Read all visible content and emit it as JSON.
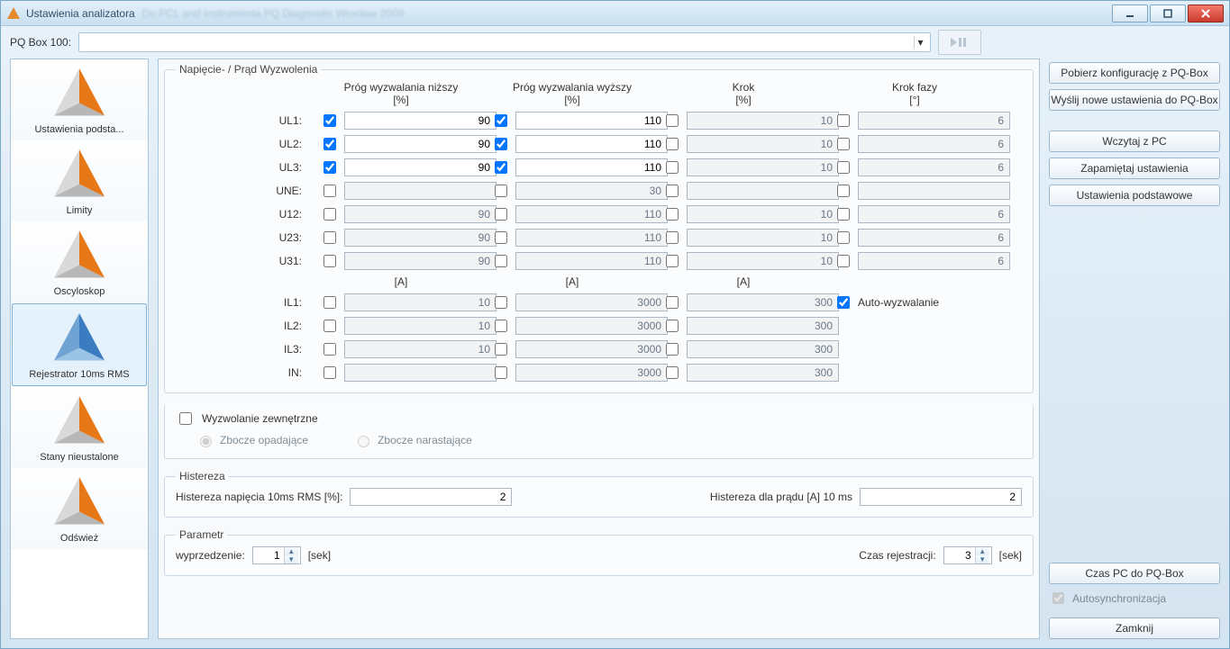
{
  "window": {
    "title": "Ustawienia analizatora",
    "blurred_extra": "Do PCL and Instrumenta PQ Diagnostic  Wrocław 2009"
  },
  "topbar": {
    "pq_label": "PQ Box 100:",
    "combo_value": ""
  },
  "sidebar": {
    "items": [
      {
        "label": "Ustawienia podsta...",
        "kind": "orange"
      },
      {
        "label": "Limity",
        "kind": "orange"
      },
      {
        "label": "Oscyloskop",
        "kind": "orange"
      },
      {
        "label": "Rejestrator 10ms RMS",
        "kind": "blue",
        "selected": true
      },
      {
        "label": "Stany nieustalone",
        "kind": "orange"
      },
      {
        "label": "Odśwież",
        "kind": "orange"
      }
    ]
  },
  "main": {
    "section_title": "Napięcie- / Prąd Wyzwolenia",
    "columns": {
      "low": {
        "title": "Próg wyzwalania niższy",
        "unit": "[%]",
        "unit2": "[A]"
      },
      "high": {
        "title": "Próg wyzwalania wyższy",
        "unit": "[%]",
        "unit2": "[A]"
      },
      "step": {
        "title": "Krok",
        "unit": "[%]",
        "unit2": "[A]"
      },
      "phase": {
        "title": "Krok fazy",
        "unit": "[°]"
      }
    },
    "rows_v": [
      {
        "label": "UL1:",
        "low": {
          "chk": true,
          "val": "90",
          "en": true
        },
        "high": {
          "chk": true,
          "val": "110",
          "en": true
        },
        "step": {
          "chk": false,
          "val": "10",
          "en": false
        },
        "phase": {
          "chk": false,
          "val": "6",
          "en": false
        }
      },
      {
        "label": "UL2:",
        "low": {
          "chk": true,
          "val": "90",
          "en": true
        },
        "high": {
          "chk": true,
          "val": "110",
          "en": true
        },
        "step": {
          "chk": false,
          "val": "10",
          "en": false
        },
        "phase": {
          "chk": false,
          "val": "6",
          "en": false
        }
      },
      {
        "label": "UL3:",
        "low": {
          "chk": true,
          "val": "90",
          "en": true
        },
        "high": {
          "chk": true,
          "val": "110",
          "en": true
        },
        "step": {
          "chk": false,
          "val": "10",
          "en": false
        },
        "phase": {
          "chk": false,
          "val": "6",
          "en": false
        }
      },
      {
        "label": "UNE:",
        "low": {
          "chk": false,
          "val": "",
          "en": false
        },
        "high": {
          "chk": false,
          "val": "30",
          "en": false
        },
        "step": {
          "chk": false,
          "val": "",
          "en": false
        },
        "phase": {
          "chk": false,
          "val": "",
          "en": false
        }
      },
      {
        "label": "U12:",
        "low": {
          "chk": false,
          "val": "90",
          "en": false
        },
        "high": {
          "chk": false,
          "val": "110",
          "en": false
        },
        "step": {
          "chk": false,
          "val": "10",
          "en": false
        },
        "phase": {
          "chk": false,
          "val": "6",
          "en": false
        }
      },
      {
        "label": "U23:",
        "low": {
          "chk": false,
          "val": "90",
          "en": false
        },
        "high": {
          "chk": false,
          "val": "110",
          "en": false
        },
        "step": {
          "chk": false,
          "val": "10",
          "en": false
        },
        "phase": {
          "chk": false,
          "val": "6",
          "en": false
        }
      },
      {
        "label": "U31:",
        "low": {
          "chk": false,
          "val": "90",
          "en": false
        },
        "high": {
          "chk": false,
          "val": "110",
          "en": false
        },
        "step": {
          "chk": false,
          "val": "10",
          "en": false
        },
        "phase": {
          "chk": false,
          "val": "6",
          "en": false
        }
      }
    ],
    "rows_i": [
      {
        "label": "IL1:",
        "low": {
          "chk": false,
          "val": "10",
          "en": false
        },
        "high": {
          "chk": false,
          "val": "3000",
          "en": false
        },
        "step": {
          "chk": false,
          "val": "300",
          "en": false
        },
        "auto": {
          "chk": true,
          "label": "Auto-wyzwalanie"
        }
      },
      {
        "label": "IL2:",
        "low": {
          "chk": false,
          "val": "10",
          "en": false
        },
        "high": {
          "chk": false,
          "val": "3000",
          "en": false
        },
        "step": {
          "chk": false,
          "val": "300",
          "en": false
        }
      },
      {
        "label": "IL3:",
        "low": {
          "chk": false,
          "val": "10",
          "en": false
        },
        "high": {
          "chk": false,
          "val": "3000",
          "en": false
        },
        "step": {
          "chk": false,
          "val": "300",
          "en": false
        }
      },
      {
        "label": "IN:",
        "low": {
          "chk": false,
          "val": "",
          "en": false
        },
        "high": {
          "chk": false,
          "val": "3000",
          "en": false
        },
        "step": {
          "chk": false,
          "val": "300",
          "en": false
        }
      }
    ],
    "ext_trigger": {
      "chk": false,
      "label": "Wyzwolanie zewnętrzne",
      "falling": "Zbocze opadające",
      "rising": "Zbocze narastające",
      "selected": "falling"
    },
    "hysteresis": {
      "legend": "Histereza",
      "v_label": "Histereza napięcia 10ms RMS  [%]:",
      "v_value": "2",
      "i_label": "Histereza dla prądu [A] 10 ms",
      "i_value": "2"
    },
    "parameter": {
      "legend": "Parametr",
      "lead_label": "wyprzedzenie:",
      "lead_value": "1",
      "unit": "[sek]",
      "rec_label": "Czas rejestracji:",
      "rec_value": "3"
    }
  },
  "right": {
    "download": "Pobierz konfigurację z PQ-Box",
    "upload": "Wyślij nowe ustawienia do PQ-Box",
    "load_pc": "Wczytaj z PC",
    "remember": "Zapamiętaj ustawienia",
    "defaults": "Ustawienia podstawowe",
    "pc_time": "Czas PC do PQ-Box",
    "autosync_chk": true,
    "autosync": "Autosynchronizacja",
    "close": "Zamknij"
  }
}
